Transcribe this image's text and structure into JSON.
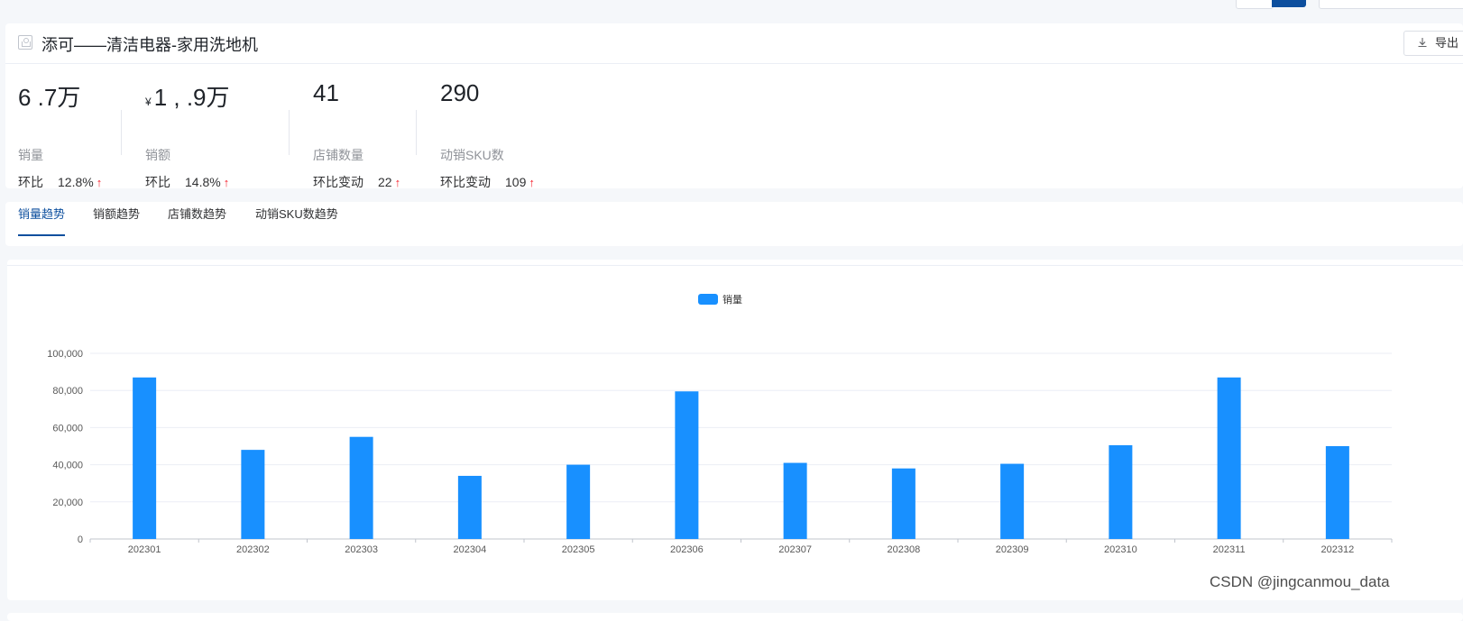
{
  "header": {
    "title": "添可——清洁电器-家用洗地机",
    "export_label": "导出"
  },
  "metrics": [
    {
      "value": "6 .7万",
      "label": "销量",
      "change_label": "环比",
      "change_value": "12.8%"
    },
    {
      "currency": "¥",
      "value": "1  ,  .9万",
      "label": "销额",
      "change_label": "环比",
      "change_value": "14.8%"
    },
    {
      "value": "41",
      "label": "店铺数量",
      "change_label": "环比变动",
      "change_value": "22"
    },
    {
      "value": "290",
      "label": "动销SKU数",
      "change_label": "环比变动",
      "change_value": "109"
    }
  ],
  "tabs": [
    {
      "label": "销量趋势",
      "active": true
    },
    {
      "label": "销额趋势",
      "active": false
    },
    {
      "label": "店铺数趋势",
      "active": false
    },
    {
      "label": "动销SKU数趋势",
      "active": false
    }
  ],
  "colors": {
    "accent": "#0d4f9e",
    "bar": "#1890ff",
    "up": "#f5222d"
  },
  "chart_data": {
    "type": "bar",
    "categories": [
      "202301",
      "202302",
      "202303",
      "202304",
      "202305",
      "202306",
      "202307",
      "202308",
      "202309",
      "202310",
      "202311",
      "202312"
    ],
    "series": [
      {
        "name": "销量",
        "values": [
          87000,
          48000,
          55000,
          34000,
          40000,
          79500,
          41000,
          38000,
          40500,
          50500,
          87000,
          50000
        ]
      }
    ],
    "ylim": [
      0,
      100000
    ],
    "yticks": [
      "0",
      "20,000",
      "40,000",
      "60,000",
      "80,000",
      "100,000"
    ],
    "legend": "top-center",
    "grid": true
  },
  "watermark": "CSDN @jingcanmou_data"
}
